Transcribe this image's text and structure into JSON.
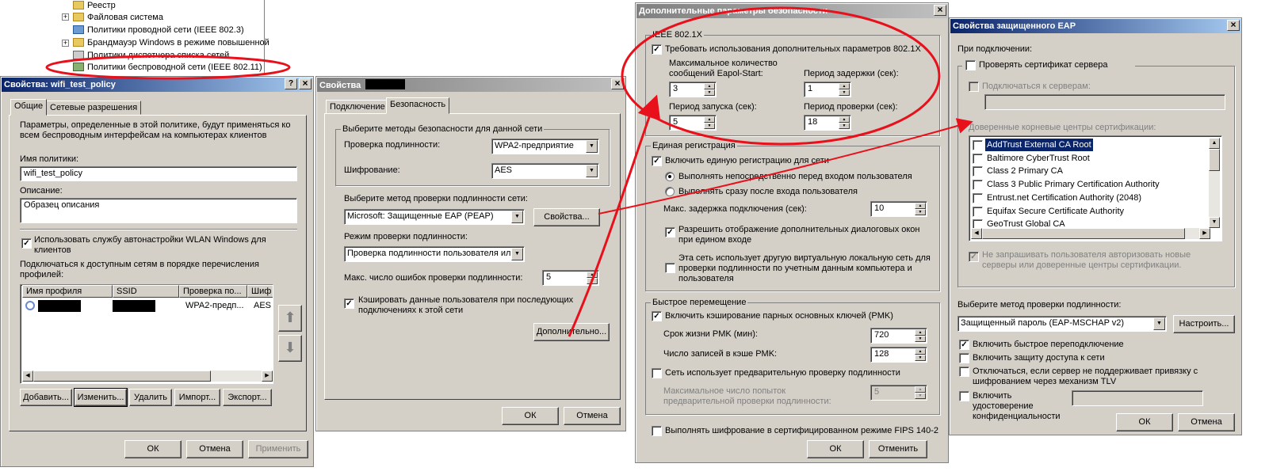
{
  "tree": {
    "items": [
      "Реестр",
      "Файловая система",
      "Политики проводной сети (IEEE 802.3)",
      "Брандмауэр Windows в режиме повышенной",
      "Политики диспетчера списка сетей",
      "Политики беспроводной сети (IEEE 802.11)"
    ]
  },
  "w1": {
    "title": "Свойства: wifi_test_policy",
    "tabs": [
      "Общие",
      "Сетевые разрешения"
    ],
    "desc": "Параметры, определенные в этой политике, будут применяться ко всем беспроводным интерфейсам на компьютерах клиентов",
    "name_label": "Имя политики:",
    "name_value": "wifi_test_policy",
    "descr_label": "Описание:",
    "descr_value": "Образец описания",
    "autoconf_label": "Использовать службу автонастройки WLAN Windows для клиентов",
    "connect_label": "Подключаться к доступным сетям  в порядке перечисления профилей:",
    "columns": [
      "Имя профиля",
      "SSID",
      "Проверка по...",
      "Шиф"
    ],
    "row": {
      "auth": "WPA2-предп...",
      "enc": "AES"
    },
    "buttons": [
      "Добавить...",
      "Изменить...",
      "Удалить",
      "Импорт...",
      "Экспорт..."
    ],
    "ok": "ОК",
    "cancel": "Отмена",
    "apply": "Применить"
  },
  "w2": {
    "title": "Свойства",
    "tabs": [
      "Подключение",
      "Безопасность"
    ],
    "group_title": "Выберите методы безопасности для данной сети",
    "auth_label": "Проверка подлинности:",
    "auth_value": "WPA2-предприятие",
    "enc_label": "Шифрование:",
    "enc_value": "AES",
    "method_label": "Выберите метод проверки подлинности сети:",
    "method_value": "Microsoft: Защищенные EAP (PEAP)",
    "props_btn": "Свойства...",
    "mode_label": "Режим проверки подлинности:",
    "mode_value": "Проверка подлинности пользователя или",
    "maxerr_label": "Макс. число ошибок проверки подлинности:",
    "maxerr_value": "5",
    "cache_label": "Кэшировать данные пользователя при последующих подключениях к этой сети",
    "adv_btn": "Дополнительно...",
    "ok": "ОК",
    "cancel": "Отмена"
  },
  "w3": {
    "title": "Дополнительные параметры безопасности",
    "ieee_group": "IEEE 802.1X",
    "ieee_check": "Требовать использования дополнительных параметров 802.1X",
    "eapol_label": "Максимальное количество сообщений Eapol-Start:",
    "eapol_value": "3",
    "delay_label": "Период задержки (сек):",
    "delay_value": "1",
    "start_label": "Период запуска (сек):",
    "start_value": "5",
    "check_label": "Период проверки (сек):",
    "check_value": "18",
    "sso_group": "Единая регистрация",
    "sso_check": "Включить единую регистрацию для сети",
    "sso_r1": "Выполнять непосредственно перед входом пользователя",
    "sso_r2": "Выполнять сразу после входа пользователя",
    "sso_delay_label": "Макс. задержка подключения (сек):",
    "sso_delay_value": "10",
    "sso_dialogs": "Разрешить отображение дополнительных диалоговых окон при едином входе",
    "sso_vlan": "Эта сеть использует другую виртуальную локальную сеть для проверки подлинности по учетным данным компьютера и пользователя",
    "fast_group": "Быстрое перемещение",
    "fast_check": "Включить кэширование парных основных ключей (PMK)",
    "pmk_life_label": "Срок жизни PMK (мин):",
    "pmk_life_value": "720",
    "pmk_cache_label": "Число записей в кэше PMK:",
    "pmk_cache_value": "128",
    "preauth_check": "Сеть использует предварительную проверку подлинности",
    "preauth_label": "Максимальное число попыток предварительной проверки подлинности:",
    "preauth_value": "5",
    "fips": "Выполнять шифрование в сертифицированном режиме FIPS 140-2",
    "ok": "ОК",
    "cancel": "Отменить"
  },
  "w4": {
    "title": "Свойства защищенного EAP",
    "on_connect": "При подключении:",
    "verify_cert": "Проверять сертификат сервера",
    "connect_servers": "Подключаться к серверам:",
    "trusted_label": "Доверенные корневые центры сертификации:",
    "cas": [
      "AddTrust External CA Root",
      "Baltimore CyberTrust Root",
      "Class 2 Primary CA",
      "Class 3 Public Primary Certification Authority",
      "Entrust.net Certification Authority (2048)",
      "Equifax Secure Certificate Authority",
      "GeoTrust Global CA"
    ],
    "no_prompt": "Не запрашивать пользователя авторизовать новые серверы или доверенные центры сертификации.",
    "method_label": "Выберите метод проверки подлинности:",
    "method_value": "Защищенный пароль (EAP-MSCHAP v2)",
    "configure_btn": "Настроить...",
    "fast_reconnect": "Включить быстрое переподключение",
    "nap": "Включить защиту доступа к сети",
    "disconnect": "Отключаться, если сервер не поддерживает привязку с шифрованием через механизм TLV",
    "identity": "Включить удостоверение конфиденциальности",
    "ok": "ОК",
    "cancel": "Отмена"
  },
  "colors": {
    "annotation": "#e8101a",
    "titlebar_active": "#0a246a",
    "titlebar_inactive": "#808080",
    "selection": "#0a246a"
  }
}
